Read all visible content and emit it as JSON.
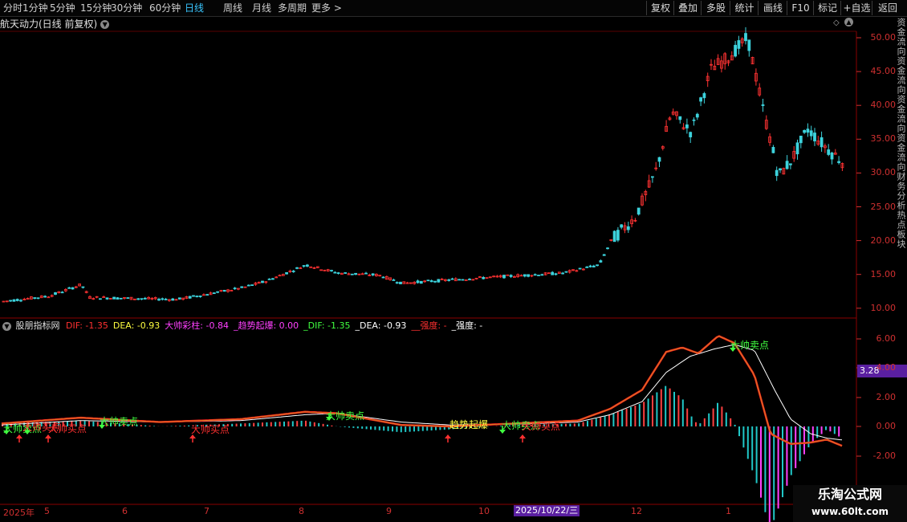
{
  "toolbar": {
    "periods": [
      "分时",
      "1分钟",
      "5分钟",
      "15分钟",
      "30分钟",
      "60分钟",
      "日线",
      "周线",
      "月线",
      "多周期",
      "更多 >"
    ],
    "active_period": "日线",
    "right_buttons": [
      "复权",
      "叠加",
      "多股",
      "统计",
      "画线",
      "F10",
      "标记",
      "+自选",
      "返回"
    ]
  },
  "chart_title": "航天动力(日线 前复权)",
  "price_axis": [
    "50.00",
    "45.00",
    "40.00",
    "35.00",
    "30.00",
    "25.00",
    "20.00",
    "15.00",
    "10.00"
  ],
  "indicator": {
    "name": "股朋指标网",
    "legend": [
      {
        "text": "DIF: -1.35",
        "color": "#ff3030"
      },
      {
        "text": "DEA: -0.93",
        "color": "#ffff40"
      },
      {
        "text": "大帅彩柱: -0.84",
        "color": "#ff40ff"
      },
      {
        "text": "_趋势起爆: 0.00",
        "color": "#ff40ff"
      },
      {
        "text": "_DIF: -1.35",
        "color": "#40ff40"
      },
      {
        "text": "_DEA: -0.93",
        "color": "#ffffff"
      },
      {
        "text": "__强度: -",
        "color": "#ff3030"
      },
      {
        "text": "_强度: -",
        "color": "#ffffff"
      }
    ],
    "axis": [
      "6.00",
      "4.00",
      "2.00",
      "0.00",
      "-2.00"
    ],
    "current_value": "3.28",
    "signals": [
      {
        "text": "大帅卖点",
        "color": "#40ff40"
      },
      {
        "text": "大帅买点",
        "color": "#ff3030"
      },
      {
        "text": "趋势起爆",
        "color": "#ffff40"
      }
    ]
  },
  "date_axis": [
    "2025年",
    "5",
    "6",
    "7",
    "8",
    "9",
    "10",
    "12",
    "1"
  ],
  "date_highlight": "2025/10/22/三",
  "side_text": "资金流向资金流向资金流向资金流向财务分析热点板块",
  "watermark": {
    "line1": "乐淘公式网",
    "line2": "www.60lt.com"
  },
  "colors": {
    "up": "#ff3232",
    "down": "#3cd2dc",
    "grid": "#5a0000",
    "dif": "#ff2020",
    "dea": "#ffffff"
  }
}
